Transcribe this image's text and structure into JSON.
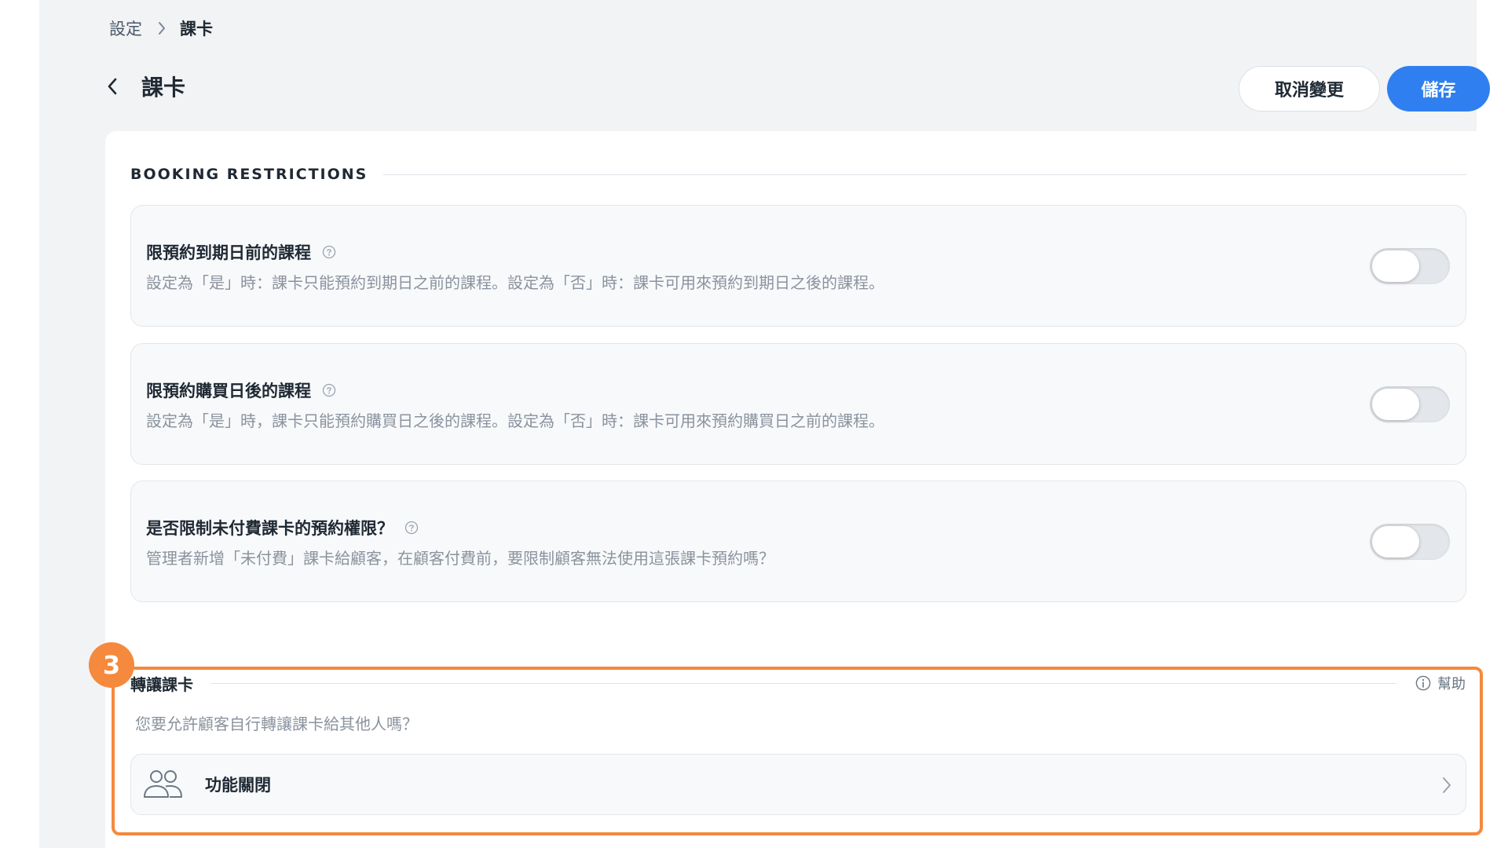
{
  "breadcrumb": {
    "parent": "設定",
    "current": "課卡"
  },
  "header": {
    "title": "課卡",
    "cancel_label": "取消變更",
    "save_label": "儲存"
  },
  "booking_restrictions": {
    "title": "BOOKING RESTRICTIONS",
    "items": [
      {
        "title": "限預約到期日前的課程",
        "description": "設定為「是」時：課卡只能預約到期日之前的課程。設定為「否」時：課卡可用來預約到期日之後的課程。",
        "enabled": false
      },
      {
        "title": "限預約購買日後的課程",
        "description": "設定為「是」時，課卡只能預約購買日之後的課程。設定為「否」時：課卡可用來預約購買日之前的課程。",
        "enabled": false
      },
      {
        "title": "是否限制未付費課卡的預約權限？",
        "description": "管理者新增「未付費」課卡給顧客，在顧客付費前，要限制顧客無法使用這張課卡預約嗎？",
        "enabled": false
      }
    ]
  },
  "transfer": {
    "step_number": "3",
    "title": "轉讓課卡",
    "help_label": "幫助",
    "description": "您要允許顧客自行轉讓課卡給其他人嗎？",
    "status_label": "功能關閉"
  },
  "colors": {
    "primary": "#2f7ff0",
    "highlight": "#f5893d",
    "page_bg": "#f1f3f5"
  },
  "icons": {
    "back": "chevron-left-icon",
    "help": "question-circle-icon",
    "info": "info-circle-icon",
    "users": "users-icon",
    "next": "chevron-right-icon"
  }
}
